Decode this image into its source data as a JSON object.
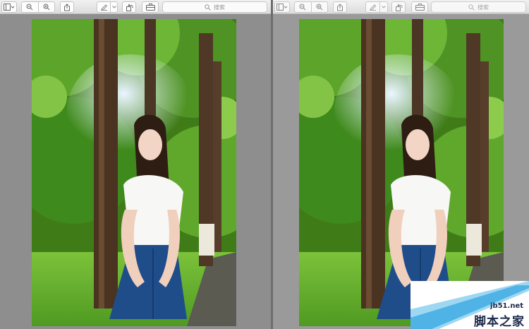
{
  "windows": [
    {
      "toolbar": {
        "sidebar_icon": "sidebar-icon",
        "zoom_out_icon": "zoom-out-icon",
        "zoom_in_icon": "zoom-in-icon",
        "share_icon": "share-icon",
        "markup_icon": "pen-icon",
        "rotate_icon": "rotate-icon",
        "toolbox_icon": "toolbox-icon",
        "search": {
          "placeholder": "搜索"
        }
      },
      "image": {
        "subject": "girl-under-trees-photo"
      }
    },
    {
      "toolbar": {
        "sidebar_icon": "sidebar-icon",
        "zoom_out_icon": "zoom-out-icon",
        "zoom_in_icon": "zoom-in-icon",
        "share_icon": "share-icon",
        "markup_icon": "pen-icon",
        "rotate_icon": "rotate-icon",
        "toolbox_icon": "toolbox-icon",
        "search": {
          "placeholder": "搜索"
        }
      },
      "image": {
        "subject": "girl-under-trees-photo"
      }
    }
  ],
  "watermark": {
    "url": "jb51.net",
    "name": "脚本之家"
  },
  "colors": {
    "toolbar_bg": "#e6e6e6",
    "window_bg": "#8e8e8e",
    "watermark_text": "#1c2a4a"
  }
}
